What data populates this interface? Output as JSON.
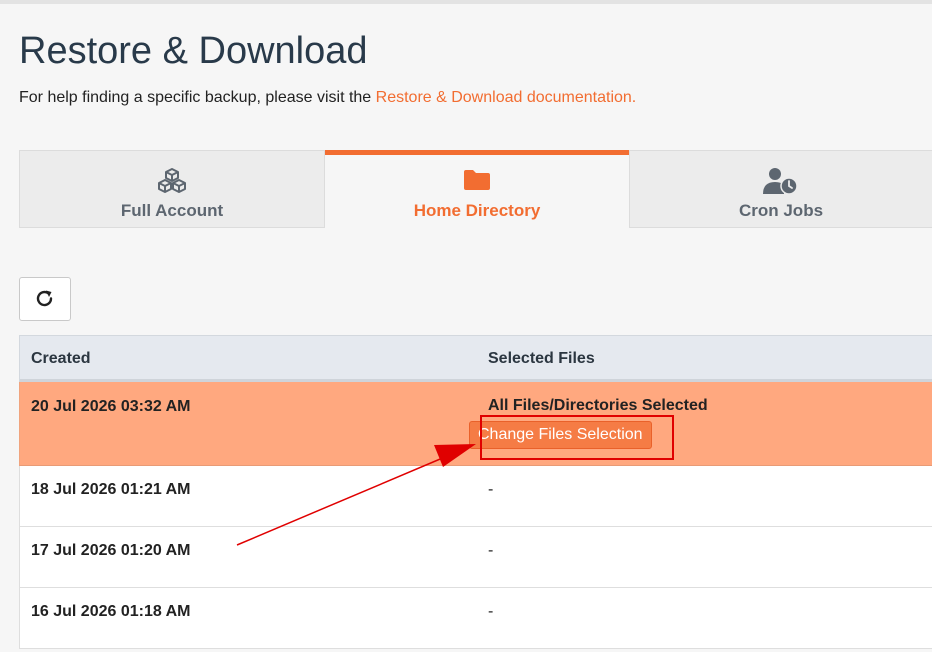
{
  "page": {
    "title": "Restore & Download",
    "help_prefix": "For help finding a specific backup, please visit the ",
    "help_link": "Restore & Download documentation."
  },
  "tabs": [
    {
      "label": "Full Account",
      "icon": "cubes-icon",
      "active": false
    },
    {
      "label": "Home Directory",
      "icon": "folder-icon",
      "active": true
    },
    {
      "label": "Cron Jobs",
      "icon": "user-clock-icon",
      "active": false
    }
  ],
  "toolbar": {
    "refresh_icon": "refresh-icon"
  },
  "table": {
    "headers": {
      "created": "Created",
      "selected_files": "Selected Files"
    },
    "rows": [
      {
        "created": "20 Jul 2026 03:32 AM",
        "selected_files": "All Files/Directories Selected",
        "action": "Change Files Selection"
      },
      {
        "created": "18 Jul 2026 01:21 AM",
        "selected_files": "-"
      },
      {
        "created": "17 Jul 2026 01:20 AM",
        "selected_files": "-"
      },
      {
        "created": "16 Jul 2026 01:18 AM",
        "selected_files": "-"
      }
    ]
  },
  "colors": {
    "accent": "#f26d31",
    "selected_row": "#ffa87f",
    "annotation": "#e00000"
  }
}
